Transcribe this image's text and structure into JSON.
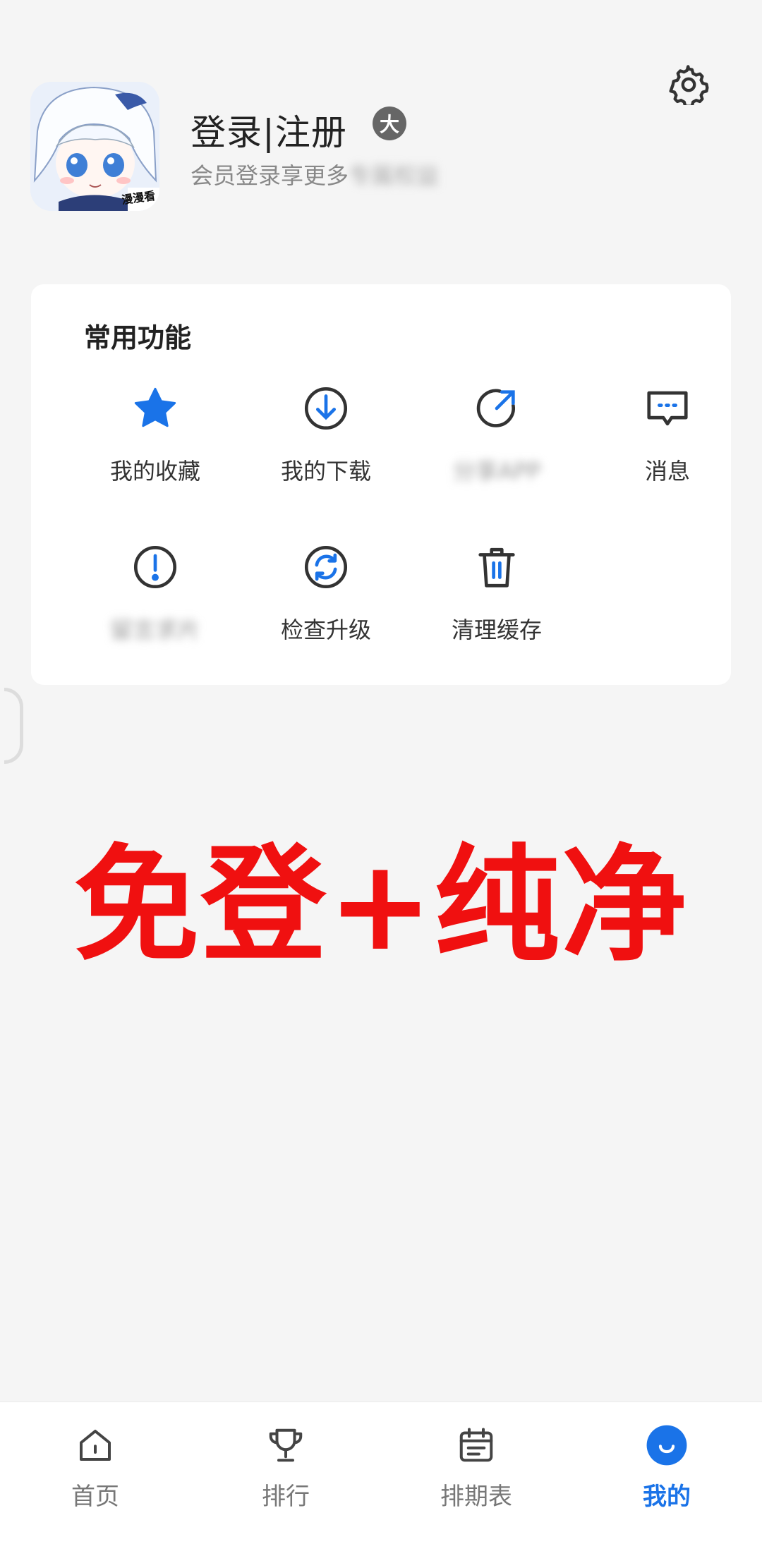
{
  "header": {
    "login_title": "登录|注册",
    "badge": "大",
    "subtitle": "会员登录享更多",
    "subtitle_blurred": "专属权益"
  },
  "card": {
    "title": "常用功能",
    "items": [
      {
        "label": "我的收藏",
        "icon": "star-icon"
      },
      {
        "label": "我的下载",
        "icon": "download-icon"
      },
      {
        "label": "分享APP",
        "icon": "share-icon",
        "blurred": true
      },
      {
        "label": "消息",
        "icon": "message-icon"
      },
      {
        "label": "留言求片",
        "icon": "alert-icon",
        "blurred": true
      },
      {
        "label": "检查升级",
        "icon": "refresh-icon"
      },
      {
        "label": "清理缓存",
        "icon": "trash-icon"
      }
    ]
  },
  "overlay_text": "免登+纯净",
  "avatar_tag": "漫漫看",
  "tabbar": {
    "items": [
      {
        "label": "首页",
        "icon": "home-icon"
      },
      {
        "label": "排行",
        "icon": "trophy-icon"
      },
      {
        "label": "排期表",
        "icon": "calendar-icon"
      },
      {
        "label": "我的",
        "icon": "profile-icon",
        "active": true
      }
    ]
  },
  "colors": {
    "accent": "#1a73e8",
    "overlay_red": "#f01010",
    "background": "#f5f5f5"
  }
}
